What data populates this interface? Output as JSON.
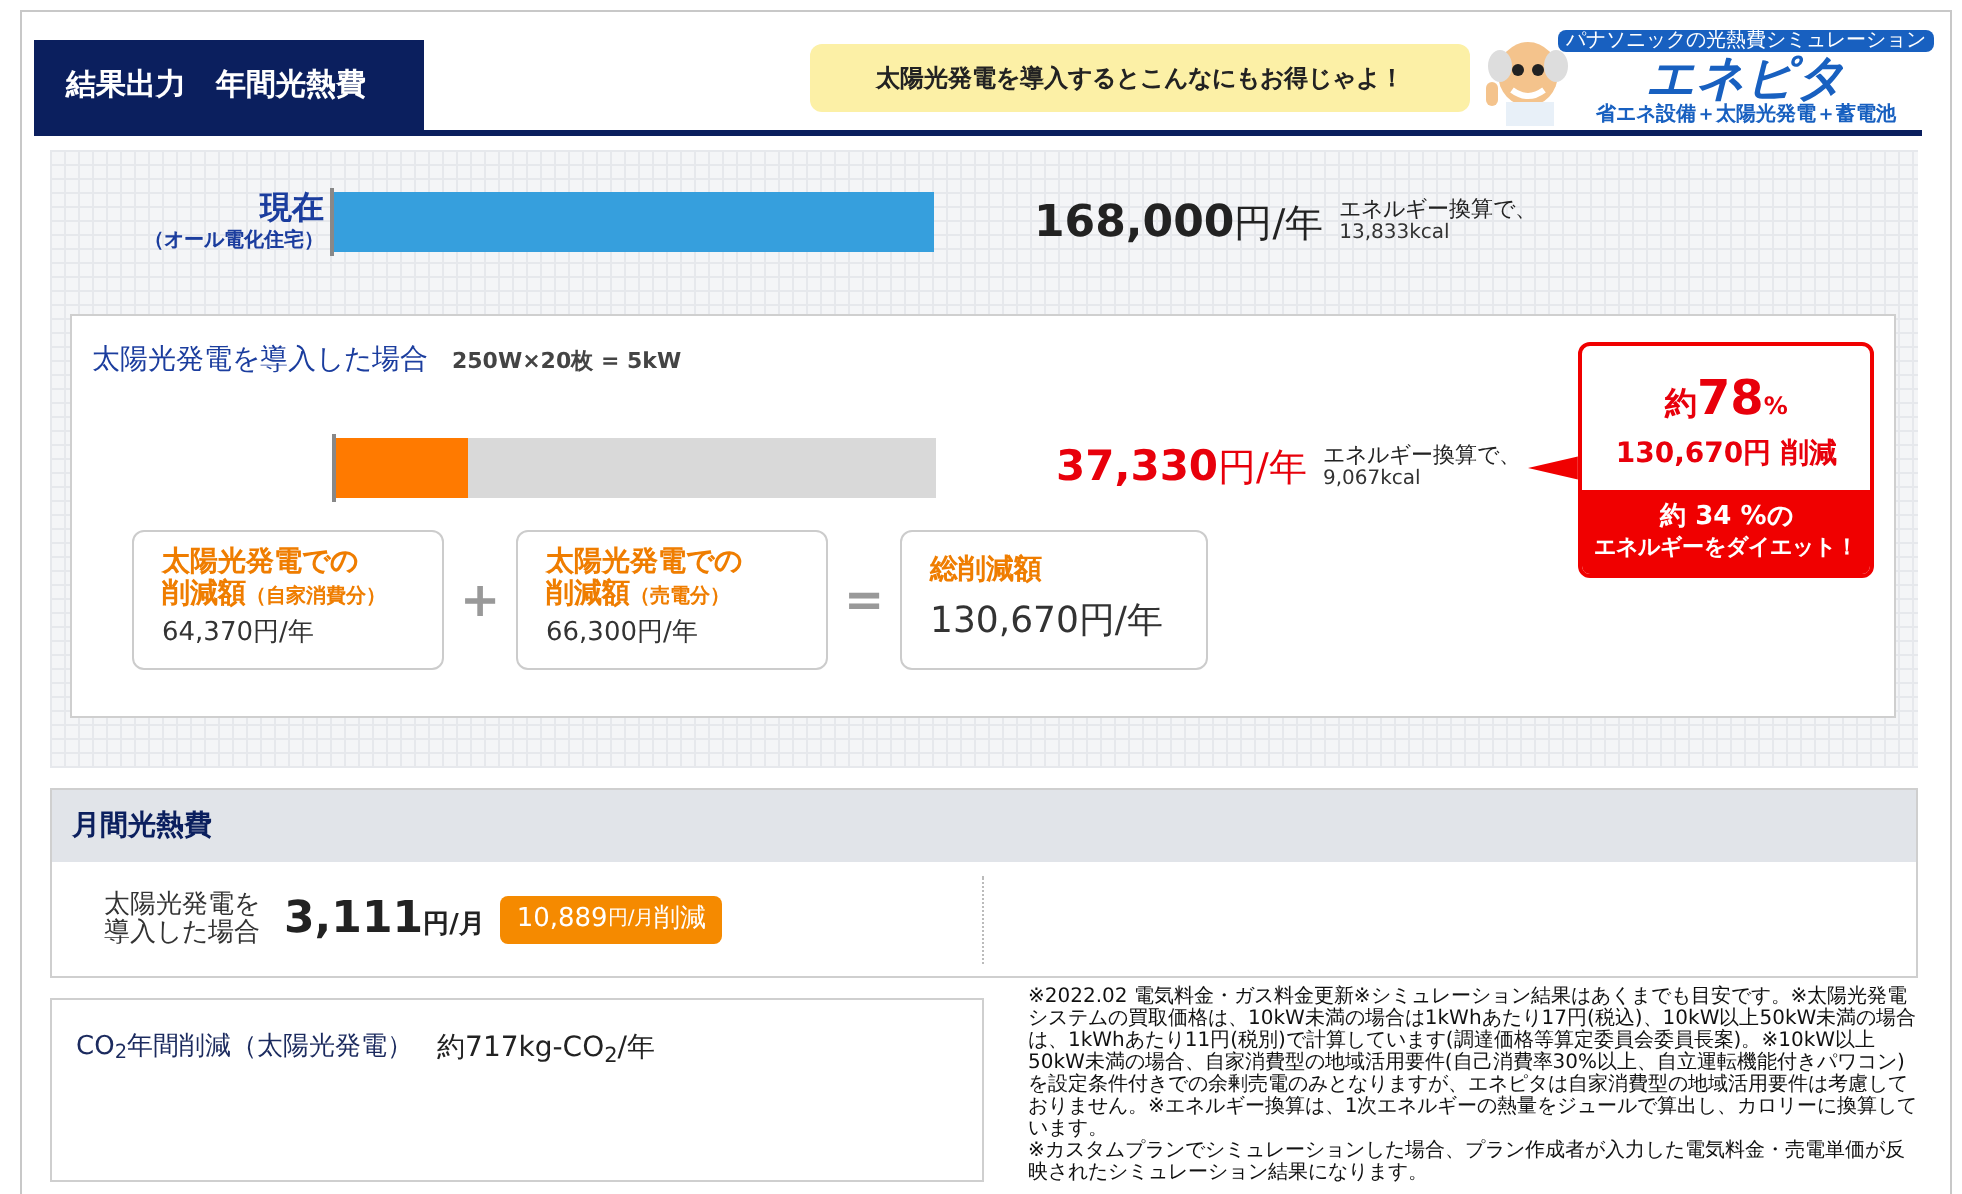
{
  "header": {
    "title": "結果出力　年間光熱費",
    "speech": "太陽光発電を導入するとこんなにもお得じゃよ！",
    "logo": {
      "tagline": "パナソニックの光熱費シミュレーション",
      "name": "エネピタ",
      "subtitle": "省エネ設備＋太陽光発電＋蓄電池"
    }
  },
  "current": {
    "label": "現在",
    "sublabel": "（オール電化住宅）",
    "level": 1,
    "amount": "168,000",
    "unit": "円/年",
    "energy_note": "エネルギー換算で、",
    "energy_value": "13,833kcal"
  },
  "solar": {
    "title": "太陽光発電を導入した場合",
    "spec": "250W×20枚 = 5kW",
    "level": 0.22,
    "amount": "37,330",
    "unit": "円/年",
    "energy_note": "エネルギー換算で、",
    "energy_value": "9,067kcal",
    "callout": {
      "prefix": "約",
      "percent": "78",
      "percent_unit": "%",
      "reduction": "130,670円 削減",
      "diet_line1": "約 34 %の",
      "diet_line2": "エネルギーをダイエット！"
    },
    "breakdown": [
      {
        "kind": "term",
        "title": "太陽光発電での",
        "title2": "削減額",
        "note": "（自家消費分）",
        "value": "64,370円/年"
      },
      {
        "kind": "operator",
        "symbol": "+"
      },
      {
        "kind": "term",
        "title": "太陽光発電での",
        "title2": "削減額",
        "note": "（売電分）",
        "value": "66,300円/年"
      },
      {
        "kind": "operator",
        "symbol": "="
      },
      {
        "kind": "total",
        "title": "総削減額",
        "value": "130,670円/年"
      }
    ]
  },
  "monthly": {
    "title": "月間光熱費",
    "label_lines": [
      "太陽光発電を",
      "導入した場合"
    ],
    "amount": "3,111",
    "unit": "円/月",
    "badge": {
      "amount": "10,889",
      "unit": "円/月",
      "suffix": "削減"
    }
  },
  "co2": {
    "label": "CO$_{2}$年間削減（太陽光発電）",
    "value": "約717kg-CO$_{2}$/年"
  },
  "footnotes": [
    "※2022.02 電気料金・ガス料金更新※シミュレーション結果はあくまでも目安です。※太陽光発電システムの買取価格は、10kW未満の場合は1kWhあたり17円(税込)、10kW以上50kW未満の場合は、1kWhあたり11円(税別)で計算しています(調達価格等算定委員会委員長案)。※10kW以上50kW未満の場合、自家消費型の地域活用要件(自己消費率30%以上、自立運転機能付きパワコン)を設定条件付きでの余剰売電のみとなりますが、エネピタは自家消費型の地域活用要件は考慮しておりません。※エネルギー換算は、1次エネルギーの熱量をジュールで算出し、カロリーに換算しています。",
    "※カスタムプランでシミュレーションした場合、プラン作成者が入力した電気料金・売電単価が反映されたシミュレーション結果になります。"
  ]
}
